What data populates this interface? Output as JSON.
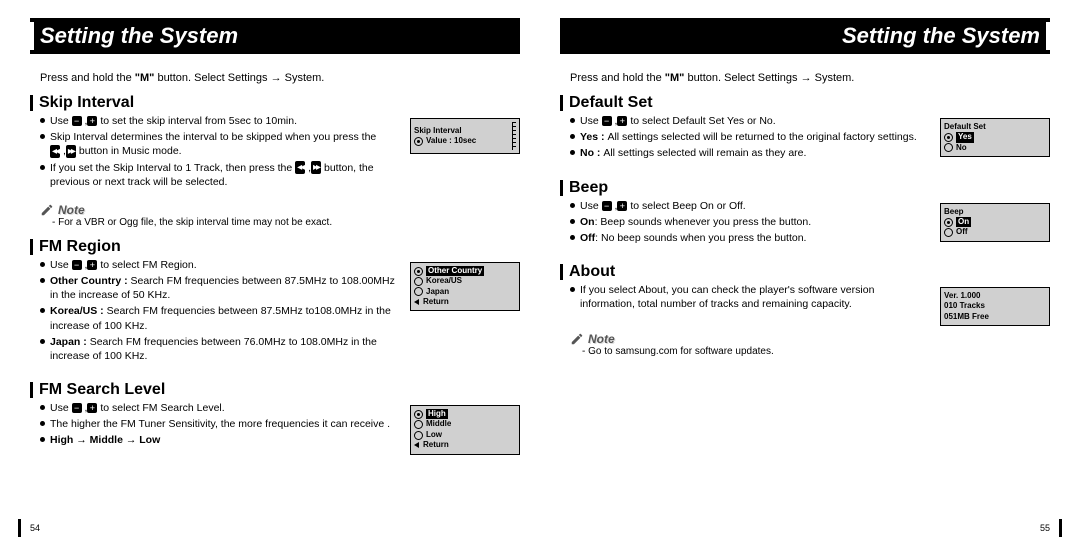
{
  "left": {
    "title": "Setting the System",
    "intro_a": "Press and hold the ",
    "intro_b": "\"M\"",
    "intro_c": " button. Select Settings → System.",
    "skip": {
      "heading": "Skip Interval",
      "b1a": "Use ",
      "b1b": " to set the skip interval from 5sec to 10min.",
      "b2a": "Skip Interval determines the interval to be skipped when you press the ",
      "b2b": " button in Music mode.",
      "b3a": "If you set the Skip Interval to 1 Track, then press the ",
      "b3b": " button, the previous or next track will be selected.",
      "note_label": "Note",
      "note_text": "- For a VBR or Ogg file, the skip interval time may not be exact.",
      "screen_title": "Skip Interval",
      "screen_value": "Value : 10sec"
    },
    "fm": {
      "heading": "FM Region",
      "b1a": "Use ",
      "b1b": " to select FM Region.",
      "b2_label": "Other Country : ",
      "b2_text": "Search FM frequencies between 87.5MHz to 108.00MHz in the increase of 50 KHz.",
      "b3_label": "Korea/US : ",
      "b3_text": "Search FM frequencies between 87.5MHz to108.0MHz in the increase of 100 KHz.",
      "b4_label": "Japan : ",
      "b4_text": "Search FM frequencies between 76.0MHz to 108.0MHz in the increase of 100 KHz.",
      "screen_sel": "Other Country",
      "screen_o2": "Korea/US",
      "screen_o3": "Japan",
      "screen_o4": "Return"
    },
    "fms": {
      "heading": "FM Search Level",
      "b1a": "Use ",
      "b1b": " to select FM Search Level.",
      "b2": "The higher the FM Tuner Sensitivity, the more frequencies it can receive .",
      "b3": "High → Middle → Low",
      "screen_sel": "High",
      "screen_o2": "Middle",
      "screen_o3": "Low",
      "screen_o4": "Return"
    },
    "page_num": "54"
  },
  "right": {
    "title": "Setting the System",
    "intro_a": "Press and hold the ",
    "intro_b": "\"M\"",
    "intro_c": " button. Select Settings → System.",
    "def": {
      "heading": "Default Set",
      "b1a": "Use ",
      "b1b": " to select Default Set Yes or No.",
      "b2_label": "Yes : ",
      "b2_text": "All settings selected will be returned to the original factory settings.",
      "b3_label": "No : ",
      "b3_text": "All settings selected will remain as they are.",
      "screen_title": "Default Set",
      "screen_sel": "Yes",
      "screen_o2": "No"
    },
    "beep": {
      "heading": "Beep",
      "b1a": "Use ",
      "b1b": " to select Beep On or Off.",
      "b2_label": "On",
      "b2_text": ": Beep sounds whenever you press the button.",
      "b3_label": "Off",
      "b3_text": ": No beep sounds when you press the button.",
      "screen_title": "Beep",
      "screen_sel": "On",
      "screen_o2": "Off"
    },
    "about": {
      "heading": "About",
      "b1": "If you select About, you can check the player's software version information, total number of tracks and remaining capacity.",
      "note_label": "Note",
      "note_text": "- Go to samsung.com for software updates.",
      "screen_l1": "Ver. 1.000",
      "screen_l2": "010 Tracks",
      "screen_l3": "051MB Free"
    },
    "page_num": "55"
  }
}
